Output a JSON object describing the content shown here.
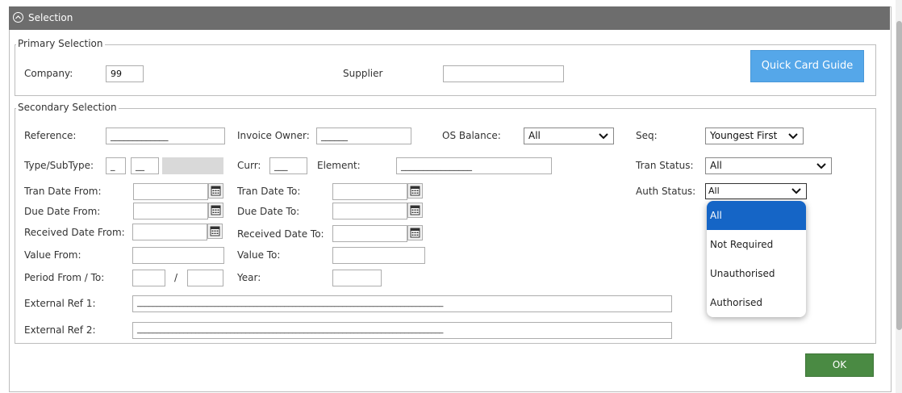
{
  "header": {
    "title": "Selection"
  },
  "primary": {
    "legend": "Primary Selection",
    "company_label": "Company:",
    "company_value": "99",
    "supplier_label": "Supplier",
    "supplier_value": "",
    "quick_card_label": "Quick Card Guide"
  },
  "secondary": {
    "legend": "Secondary Selection",
    "reference_label": "Reference:",
    "reference_value": "_____________",
    "invoice_owner_label": "Invoice Owner:",
    "invoice_owner_value": "______",
    "os_balance_label": "OS Balance:",
    "os_balance_value": "All",
    "seq_label": "Seq:",
    "seq_value": "Youngest First",
    "type_label": "Type/SubType:",
    "type_value": "_",
    "subtype_value": "__",
    "curr_label": "Curr:",
    "curr_value": "___",
    "element_label": "Element:",
    "element_value": "________________",
    "tran_status_label": "Tran Status:",
    "tran_status_value": "All",
    "tran_date_from_label": "Tran Date From:",
    "tran_date_to_label": "Tran Date To:",
    "auth_status_label": "Auth Status:",
    "auth_status_value": "All",
    "due_date_from_label": "Due Date From:",
    "due_date_to_label": "Due Date To:",
    "received_date_from_label": "Received Date From:",
    "received_date_to_label": "Received Date To:",
    "value_from_label": "Value From:",
    "value_to_label": "Value To:",
    "period_label": "Period From / To:",
    "period_sep": "/",
    "year_label": "Year:",
    "ext_ref1_label": "External Ref 1:",
    "ext_ref1_value": "_______________________________________________________________________________",
    "ext_ref2_label": "External Ref 2:",
    "ext_ref2_value": "_______________________________________________________________________________"
  },
  "auth_dropdown": {
    "options": [
      "All",
      "Not Required",
      "Unauthorised",
      "Authorised"
    ],
    "selected": "All"
  },
  "footer": {
    "ok_label": "OK"
  },
  "colors": {
    "header": "#6d6d6d",
    "quick_card": "#55a7e9",
    "ok": "#4a8a43",
    "dropdown_selected": "#1565c6"
  },
  "icons": {
    "collapse": "chevron-up-circle-icon",
    "calendar": "calendar-icon",
    "chevron": "chevron-down-icon"
  }
}
